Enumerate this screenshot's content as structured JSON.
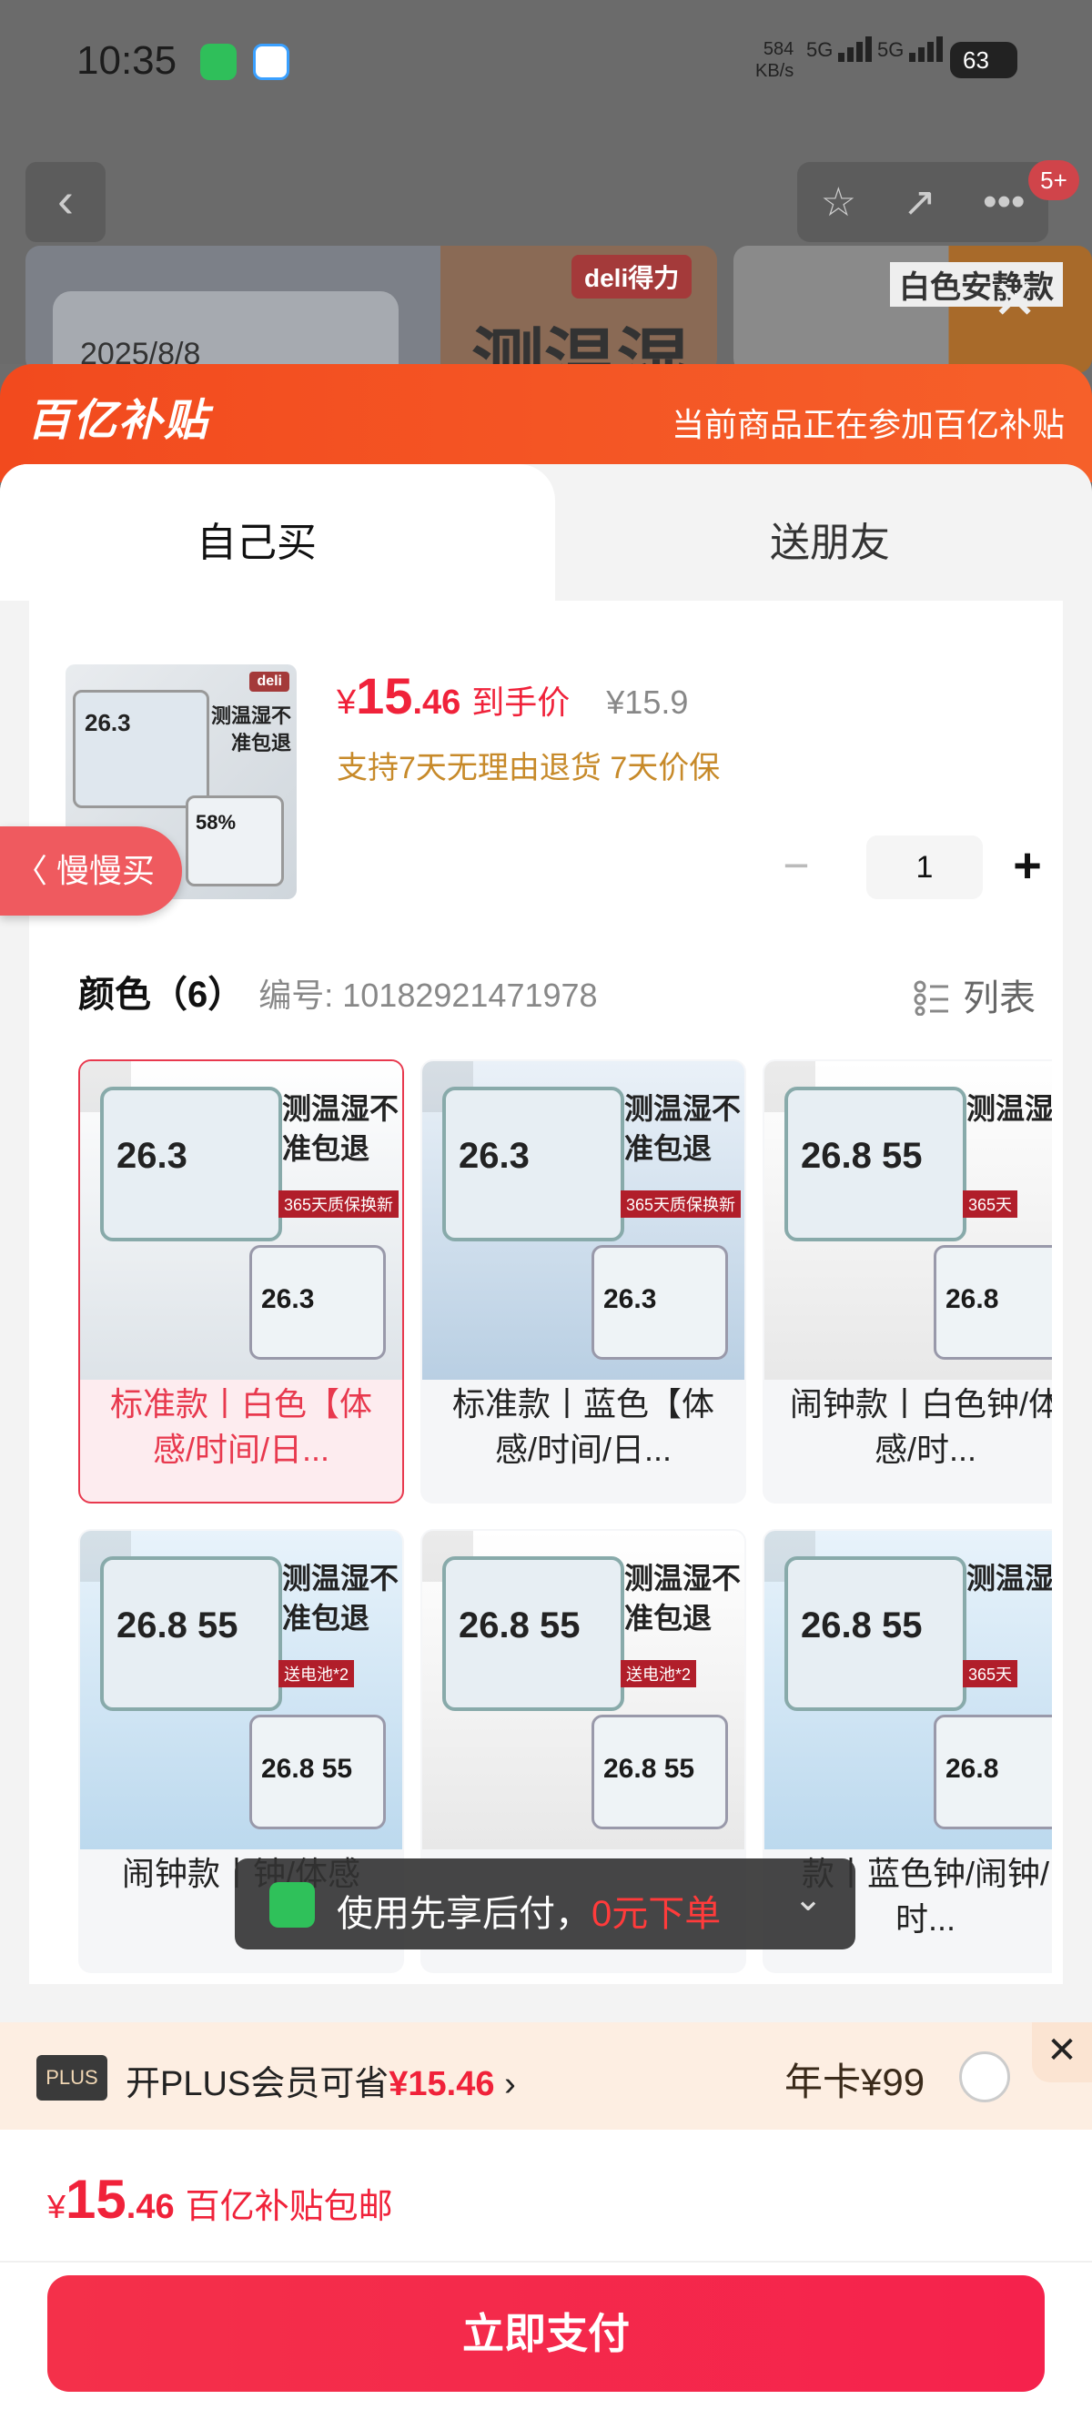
{
  "status_bar": {
    "time": "10:35",
    "net_speed_value": "584",
    "net_speed_unit": "KB/s",
    "signal_1": "5G",
    "signal_2": "5G",
    "battery": "63"
  },
  "bg_top": {
    "brand_chip": "deli得力",
    "headline_fragment": "测温湿",
    "lcd_date": "2025/8/8",
    "thumb2_label": "白色安静款"
  },
  "subsidy": {
    "logo": "百亿补贴",
    "note": "当前商品正在参加百亿补贴"
  },
  "tabs": {
    "self": "自己买",
    "gift": "送朋友"
  },
  "product": {
    "img_chip": "deli",
    "img_lcd_temp": "26.3",
    "img_lcd_hum": "58%",
    "img_headline": "测温湿不准包退",
    "price_yen": "¥",
    "price_int": "15",
    "price_dec": ".46",
    "price_label": "到手价",
    "orig_price": "¥15.9",
    "policy": "支持7天无理由退货  7天价保",
    "qty_minus": "−",
    "qty": "1",
    "qty_plus": "+"
  },
  "slow_buy": "〈 慢慢买",
  "colors": {
    "title": "颜色（6）",
    "code": "编号: 10182921471978",
    "list_btn": "列表",
    "items": [
      {
        "label": "标准款丨白色【体感/时间/日...",
        "lcd": "26.3",
        "mini": "26.3",
        "headline": "测温湿不准包退",
        "tag": "365天质保换新"
      },
      {
        "label": "标准款丨蓝色【体感/时间/日...",
        "lcd": "26.3",
        "mini": "26.3",
        "headline": "测温湿不准包退",
        "tag": "365天质保换新"
      },
      {
        "label": "闹钟款丨白色钟/体感/时...",
        "lcd": "26.8 55",
        "mini": "26.8",
        "headline": "测温湿",
        "tag": "365天"
      },
      {
        "label": "闹钟款丨钟/体感",
        "lcd": "26.8 55",
        "mini": "26.8 55",
        "headline": "测温湿不准包退",
        "tag": "送电池*2"
      },
      {
        "label": "",
        "lcd": "26.8 55",
        "mini": "26.8 55",
        "headline": "测温湿不准包退",
        "tag": "送电池*2"
      },
      {
        "label": "款丨蓝色钟/闹钟/时...",
        "lcd": "26.8 55",
        "mini": "26.8",
        "headline": "测温湿",
        "tag": "365天"
      }
    ]
  },
  "toast": {
    "text": "使用先享后付，",
    "highlight": "0元下单",
    "chevron": "⌄"
  },
  "plus": {
    "tag": "PLUS",
    "text": "开PLUS会员可省",
    "save": "¥15.46",
    "arrow": "›",
    "card_price": "年卡¥99",
    "close": "✕"
  },
  "bottom": {
    "yen": "¥",
    "int": "15",
    "dec": ".46",
    "label": "百亿补贴包邮",
    "pay_button": "立即支付"
  },
  "header_actions": {
    "back": "‹",
    "star": "☆",
    "share": "↗",
    "more": "•••",
    "badge": "5+"
  },
  "overlay_close": "✕"
}
